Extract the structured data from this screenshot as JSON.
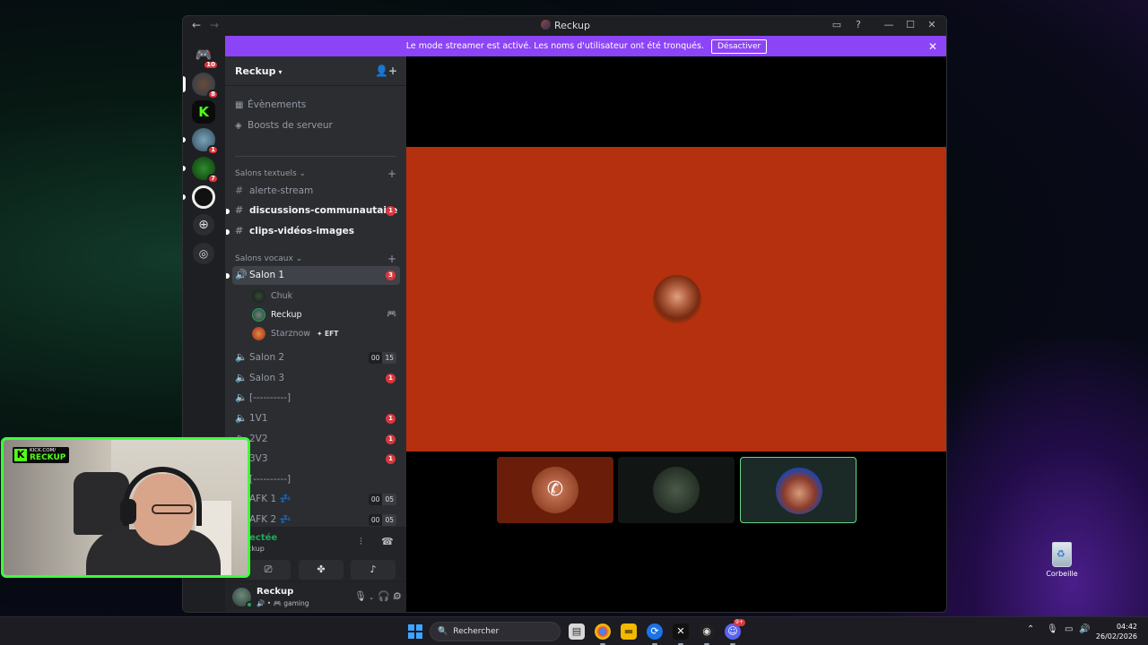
{
  "window": {
    "title": "Reckup",
    "nav_back": "←",
    "nav_forward": "→",
    "controls": {
      "inbox": "▭",
      "help": "?",
      "minimize": "—",
      "maximize": "☐",
      "close": "✕"
    }
  },
  "rail": {
    "home_badge": "10",
    "servers": [
      {
        "badge": "8"
      },
      {
        "badge": ""
      },
      {
        "badge": "1"
      },
      {
        "badge": "7"
      },
      {
        "badge": ""
      }
    ]
  },
  "banner": {
    "message": "Le mode streamer est activé. Les noms d'utilisateur ont été tronqués.",
    "button": "Désactiver"
  },
  "server": {
    "name": "Reckup",
    "links": [
      {
        "icon": "calendar-icon",
        "label": "Évènements"
      },
      {
        "icon": "boost-icon",
        "label": "Boosts de serveur"
      }
    ],
    "text_category": "Salons textuels",
    "text_channels": [
      {
        "name": "alerte-stream",
        "unread": false,
        "badge": ""
      },
      {
        "name": "discussions-communautaire",
        "unread": true,
        "badge": "1"
      },
      {
        "name": "clips-vidéos-images",
        "unread": true,
        "badge": ""
      }
    ],
    "voice_category": "Salons vocaux",
    "voice_channels": [
      {
        "name": "Salon 1",
        "badge": "3"
      },
      {
        "name": "Salon 2",
        "count_a": "00",
        "count_b": "15"
      },
      {
        "name": "Salon 3",
        "badge": "1"
      },
      {
        "name": "[----------]"
      },
      {
        "name": "1V1",
        "badge": "1"
      },
      {
        "name": "2V2",
        "badge": "1"
      },
      {
        "name": "3V3",
        "badge": "1"
      },
      {
        "name": "[----------]"
      },
      {
        "name": "AFK 1 💤",
        "count_a": "00",
        "count_b": "05"
      },
      {
        "name": "AFK 2 💤",
        "count_a": "00",
        "count_b": "05"
      }
    ],
    "members": [
      {
        "name": "Chuk",
        "extra": ""
      },
      {
        "name": "Reckup",
        "extra": ""
      },
      {
        "name": "Starznow",
        "extra": "EFT"
      }
    ]
  },
  "voice": {
    "state": "nectée",
    "channel": "eckup"
  },
  "user": {
    "name": "Reckup",
    "status": "gaming"
  },
  "webcam": {
    "kick_small": "KICK.COM/",
    "kick_big": "RECKUP"
  },
  "desktop": {
    "recycle_bin": "Corbeille"
  },
  "taskbar": {
    "search_placeholder": "Rechercher",
    "discord_badge": "9+",
    "time": "04:42",
    "date": "26/02/2026"
  }
}
